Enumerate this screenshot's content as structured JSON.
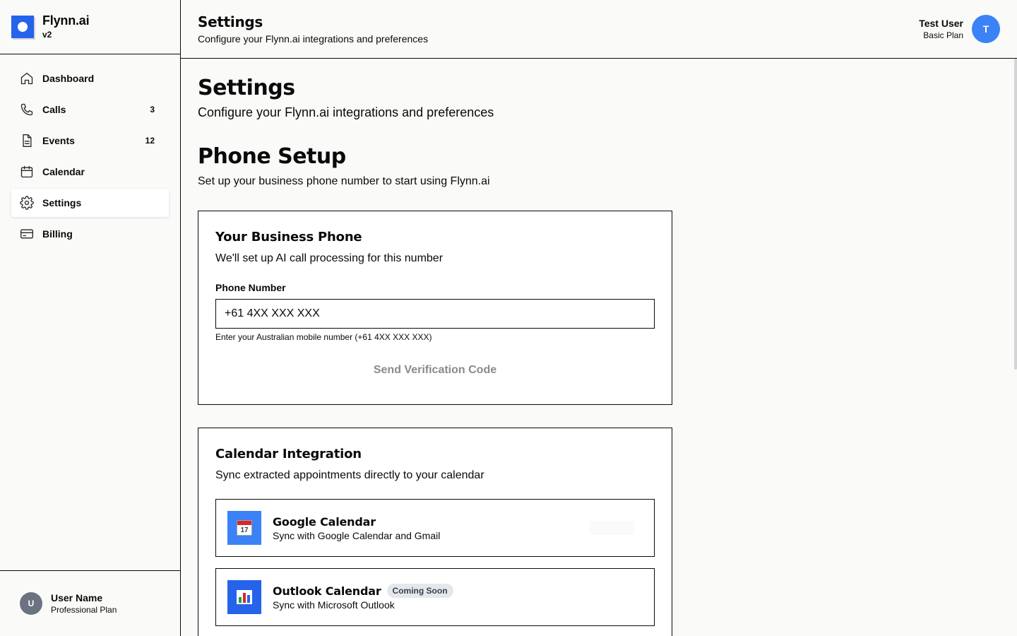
{
  "brand": {
    "name": "Flynn.ai",
    "version": "v2"
  },
  "nav": [
    {
      "label": "Dashboard",
      "icon": "home-icon",
      "badge": ""
    },
    {
      "label": "Calls",
      "icon": "phone-icon",
      "badge": "3"
    },
    {
      "label": "Events",
      "icon": "document-icon",
      "badge": "12"
    },
    {
      "label": "Calendar",
      "icon": "calendar-icon",
      "badge": ""
    },
    {
      "label": "Settings",
      "icon": "gear-icon",
      "badge": "",
      "active": true
    },
    {
      "label": "Billing",
      "icon": "credit-card-icon",
      "badge": ""
    }
  ],
  "sidebar_user": {
    "initial": "U",
    "name": "User Name",
    "plan": "Professional Plan"
  },
  "topbar": {
    "title": "Settings",
    "subtitle": "Configure your Flynn.ai integrations and preferences",
    "user_name": "Test User",
    "user_plan": "Basic Plan",
    "user_initial": "T"
  },
  "page": {
    "title": "Settings",
    "subtitle": "Configure your Flynn.ai integrations and preferences"
  },
  "phone_setup": {
    "title": "Phone Setup",
    "subtitle": "Set up your business phone number to start using Flynn.ai",
    "card_title": "Your Business Phone",
    "card_subtitle": "We'll set up AI call processing for this number",
    "field_label": "Phone Number",
    "field_value": "+61 4XX XXX XXX",
    "hint": "Enter your Australian mobile number (+61 4XX XXX XXX)",
    "button": "Send Verification Code"
  },
  "calendar_integration": {
    "title": "Calendar Integration",
    "subtitle": "Sync extracted appointments directly to your calendar",
    "items": [
      {
        "title": "Google Calendar",
        "subtitle": "Sync with Google Calendar and Gmail",
        "icon": "calendar-emoji-icon",
        "icon_text": "17",
        "badge": ""
      },
      {
        "title": "Outlook Calendar",
        "subtitle": "Sync with Microsoft Outlook",
        "icon": "bar-chart-emoji-icon",
        "badge": "Coming Soon"
      }
    ]
  },
  "colors": {
    "accent": "#2563eb",
    "avatar_blue": "#3b82f6",
    "avatar_gray": "#6b7280"
  }
}
